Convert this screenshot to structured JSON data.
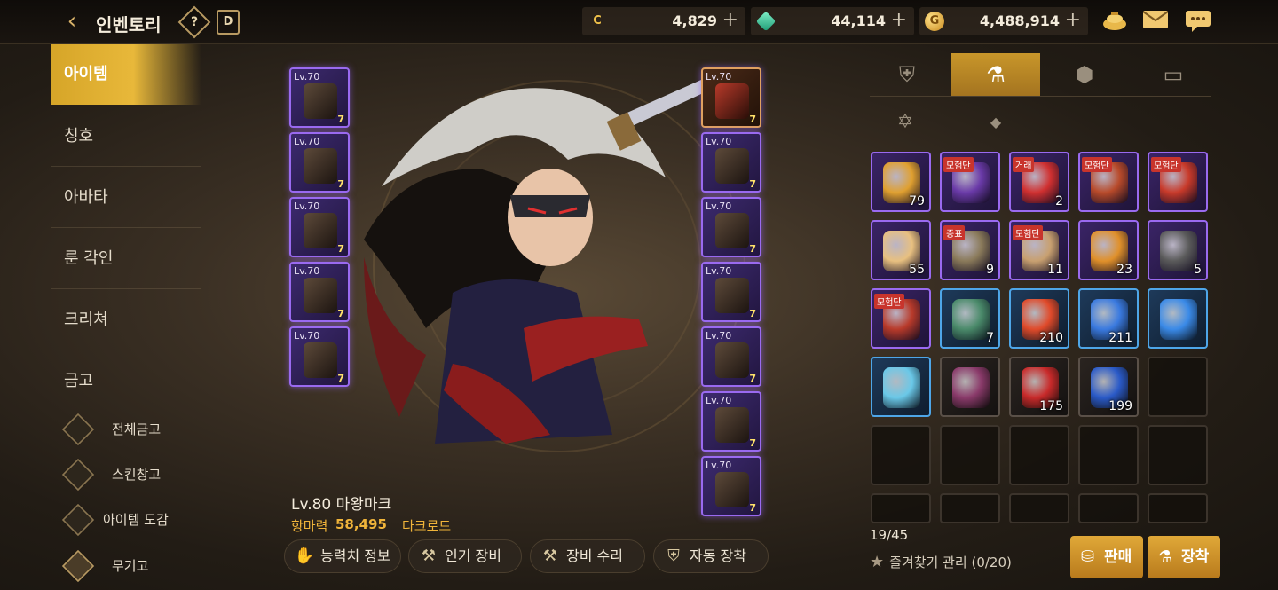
{
  "header": {
    "title": "인벤토리",
    "back_icon": "back-arrow-icon",
    "help_icon_text": "?",
    "calendar_icon_text": "D",
    "currencies": [
      {
        "icon": "c-coin-icon",
        "icon_text": "C",
        "value": "4,829"
      },
      {
        "icon": "green-gem-icon",
        "icon_text": "",
        "value": "44,114"
      },
      {
        "icon": "gold-coin-icon",
        "icon_text": "G",
        "value": "4,488,914"
      }
    ],
    "plus": "+",
    "icons": [
      "coin-pouch-icon",
      "mail-icon",
      "chat-icon"
    ]
  },
  "menu": {
    "items": [
      {
        "label": "아이템",
        "active": true
      },
      {
        "label": "칭호"
      },
      {
        "label": "아바타"
      },
      {
        "label": "룬 각인"
      },
      {
        "label": "크리쳐"
      },
      {
        "label": "금고"
      }
    ],
    "sub_items": [
      {
        "label": "전체금고"
      },
      {
        "label": "스킨창고"
      },
      {
        "label": "아이템 도감"
      },
      {
        "label": "무기고"
      }
    ]
  },
  "character": {
    "name": "Lv.80 마왕마크",
    "power_label": "항마력",
    "power_value": "58,495",
    "class": "다크로드"
  },
  "equipment": {
    "left": [
      {
        "lv": "Lv.70",
        "count": "7"
      },
      {
        "lv": "Lv.70",
        "count": "7"
      },
      {
        "lv": "Lv.70",
        "count": "7"
      },
      {
        "lv": "Lv.70",
        "count": "7"
      },
      {
        "lv": "Lv.70",
        "count": "7"
      }
    ],
    "right": [
      {
        "lv": "Lv.70",
        "count": "7"
      },
      {
        "lv": "Lv.70",
        "count": "7"
      },
      {
        "lv": "Lv.70",
        "count": "7"
      },
      {
        "lv": "Lv.70",
        "count": "7"
      },
      {
        "lv": "Lv.70",
        "count": "7"
      },
      {
        "lv": "Lv.70",
        "count": "7"
      },
      {
        "lv": "Lv.70",
        "count": "7"
      }
    ]
  },
  "actions": [
    {
      "label": "능력치 정보",
      "icon": "stats-icon"
    },
    {
      "label": "인기 장비",
      "icon": "anvil-icon"
    },
    {
      "label": "장비 수리",
      "icon": "repair-icon"
    },
    {
      "label": "자동 장착",
      "icon": "armor-icon"
    }
  ],
  "inventory": {
    "tabs": [
      "equipment-tab-icon",
      "consumable-tab-icon",
      "material-tab-icon",
      "cards-tab-icon"
    ],
    "subtabs": [
      "hexagram-icon",
      "n-badge-icon"
    ],
    "items": [
      {
        "frame": "purple",
        "qty": "79",
        "color": "#e0a030"
      },
      {
        "frame": "purple",
        "qty": "",
        "color": "#6a3aa8",
        "tag": "모험단"
      },
      {
        "frame": "purple",
        "qty": "2",
        "color": "#d03030",
        "tag": "거래"
      },
      {
        "frame": "purple",
        "qty": "",
        "color": "#b84a2a",
        "tag": "모험단"
      },
      {
        "frame": "purple",
        "qty": "",
        "color": "#c83a2a",
        "tag": "모험단"
      },
      {
        "frame": "purple",
        "qty": "55",
        "color": "#e8c080"
      },
      {
        "frame": "purple",
        "qty": "9",
        "color": "#8a7a5a",
        "tag": "증표"
      },
      {
        "frame": "purple",
        "qty": "11",
        "color": "#c8a070",
        "tag": "모험단"
      },
      {
        "frame": "purple",
        "qty": "23",
        "color": "#e0902a"
      },
      {
        "frame": "purple",
        "qty": "5",
        "color": "#5a5a5a"
      },
      {
        "frame": "purple",
        "qty": "",
        "color": "#b83a2a",
        "tag": "모험단"
      },
      {
        "frame": "blue",
        "qty": "7",
        "color": "#4a8a6a"
      },
      {
        "frame": "blue",
        "qty": "210",
        "color": "#e04a2a"
      },
      {
        "frame": "blue",
        "qty": "211",
        "color": "#3a7ae0"
      },
      {
        "frame": "blue",
        "qty": "",
        "color": "#3a8ae8"
      },
      {
        "frame": "blue",
        "qty": "",
        "color": "#6ac8e8"
      },
      {
        "frame": "dark",
        "qty": "",
        "color": "#8a3a6a"
      },
      {
        "frame": "dark",
        "qty": "175",
        "color": "#c82a2a"
      },
      {
        "frame": "dark",
        "qty": "199",
        "color": "#2a5ac8"
      },
      {
        "frame": "empty"
      },
      {
        "frame": "empty"
      },
      {
        "frame": "empty"
      },
      {
        "frame": "empty"
      },
      {
        "frame": "empty"
      },
      {
        "frame": "empty"
      },
      {
        "frame": "empty"
      },
      {
        "frame": "empty"
      },
      {
        "frame": "empty"
      },
      {
        "frame": "empty"
      },
      {
        "frame": "empty"
      }
    ],
    "count": "19/45",
    "favorites": "즐겨찾기 관리 (0/20)"
  },
  "buttons": {
    "sell": "판매",
    "equip": "장착"
  },
  "colors": {
    "accent": "#d6a528",
    "rare_purple": "#9a6af0",
    "uncommon_blue": "#4ea6e8",
    "power_orange": "#f0b43a"
  }
}
